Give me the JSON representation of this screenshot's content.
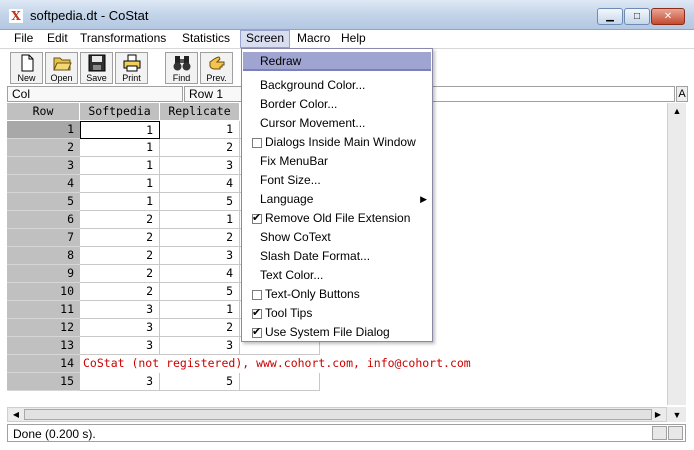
{
  "window": {
    "icon_glyph": "X",
    "title": "softpedia.dt - CoStat",
    "min_glyph": "▁",
    "max_glyph": "□",
    "close_glyph": "✕"
  },
  "menubar": {
    "items": [
      "File",
      "Edit",
      "Transformations",
      "Statistics",
      "Screen",
      "Macro",
      "Help"
    ],
    "active": "Screen"
  },
  "toolbar": {
    "buttons": [
      {
        "label": "New",
        "icon": "new-file-icon"
      },
      {
        "label": "Open",
        "icon": "open-folder-icon"
      },
      {
        "label": "Save",
        "icon": "save-disk-icon"
      },
      {
        "label": "Print",
        "icon": "printer-icon"
      },
      {
        "label": "Find",
        "icon": "binoculars-icon"
      },
      {
        "label": "Prev.",
        "icon": "prev-hand-icon"
      }
    ]
  },
  "cellref": {
    "col": "Col",
    "row": "Row 1",
    "side_button": "A"
  },
  "grid": {
    "columns": [
      "Row",
      "Softpedia",
      "Replicate"
    ],
    "rows": [
      {
        "n": "1",
        "a": "1",
        "b": "1"
      },
      {
        "n": "2",
        "a": "1",
        "b": "2"
      },
      {
        "n": "3",
        "a": "1",
        "b": "3"
      },
      {
        "n": "4",
        "a": "1",
        "b": "4"
      },
      {
        "n": "5",
        "a": "1",
        "b": "5"
      },
      {
        "n": "6",
        "a": "2",
        "b": "1"
      },
      {
        "n": "7",
        "a": "2",
        "b": "2"
      },
      {
        "n": "8",
        "a": "2",
        "b": "3"
      },
      {
        "n": "9",
        "a": "2",
        "b": "4"
      },
      {
        "n": "10",
        "a": "2",
        "b": "5"
      },
      {
        "n": "11",
        "a": "3",
        "b": "1"
      },
      {
        "n": "12",
        "a": "3",
        "b": "2"
      },
      {
        "n": "13",
        "a": "3",
        "b": "3"
      },
      {
        "n": "14",
        "notice": "CoStat (not registered), www.cohort.com, info@cohort.com"
      },
      {
        "n": "15",
        "a": "3",
        "b": "5"
      }
    ]
  },
  "scroll": {
    "up": "▲",
    "down": "▼",
    "left": "◀",
    "right": "▶"
  },
  "status": {
    "text": "Done (0.200 s)."
  },
  "screen_menu": {
    "items": [
      {
        "label": "Redraw",
        "highlighted": true
      },
      {
        "label": "Background Color..."
      },
      {
        "label": "Border Color..."
      },
      {
        "label": "Cursor Movement..."
      },
      {
        "label": "Dialogs Inside Main Window",
        "checkbox": true,
        "checked": false
      },
      {
        "label": "Fix MenuBar"
      },
      {
        "label": "Font Size..."
      },
      {
        "label": "Language",
        "submenu": true,
        "submenu_glyph": "▶"
      },
      {
        "label": "Remove Old File Extension",
        "checkbox": true,
        "checked": true
      },
      {
        "label": "Show CoText"
      },
      {
        "label": "Slash Date Format..."
      },
      {
        "label": "Text Color..."
      },
      {
        "label": "Text-Only Buttons",
        "checkbox": true,
        "checked": false
      },
      {
        "label": "Tool Tips",
        "checkbox": true,
        "checked": true
      },
      {
        "label": "Use System File Dialog",
        "checkbox": true,
        "checked": true
      }
    ]
  }
}
